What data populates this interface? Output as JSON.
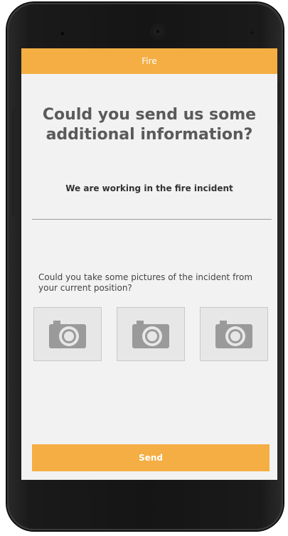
{
  "appbar": {
    "title": "Fire"
  },
  "main": {
    "heading": "Could you send us some additional information?",
    "status_text": "We are working in the fire incident",
    "photo_prompt": "Could you take some pictures of the incident from your current position?",
    "photo_slots": [
      {
        "icon": "camera-icon"
      },
      {
        "icon": "camera-icon"
      },
      {
        "icon": "camera-icon"
      }
    ]
  },
  "footer": {
    "send_label": "Send"
  },
  "colors": {
    "accent": "#f4ae43",
    "screen_bg": "#f2f2f2",
    "photo_bg": "#e7e7e7",
    "camera_icon": "#9a9a9a",
    "heading_text": "#5a5a5a"
  }
}
